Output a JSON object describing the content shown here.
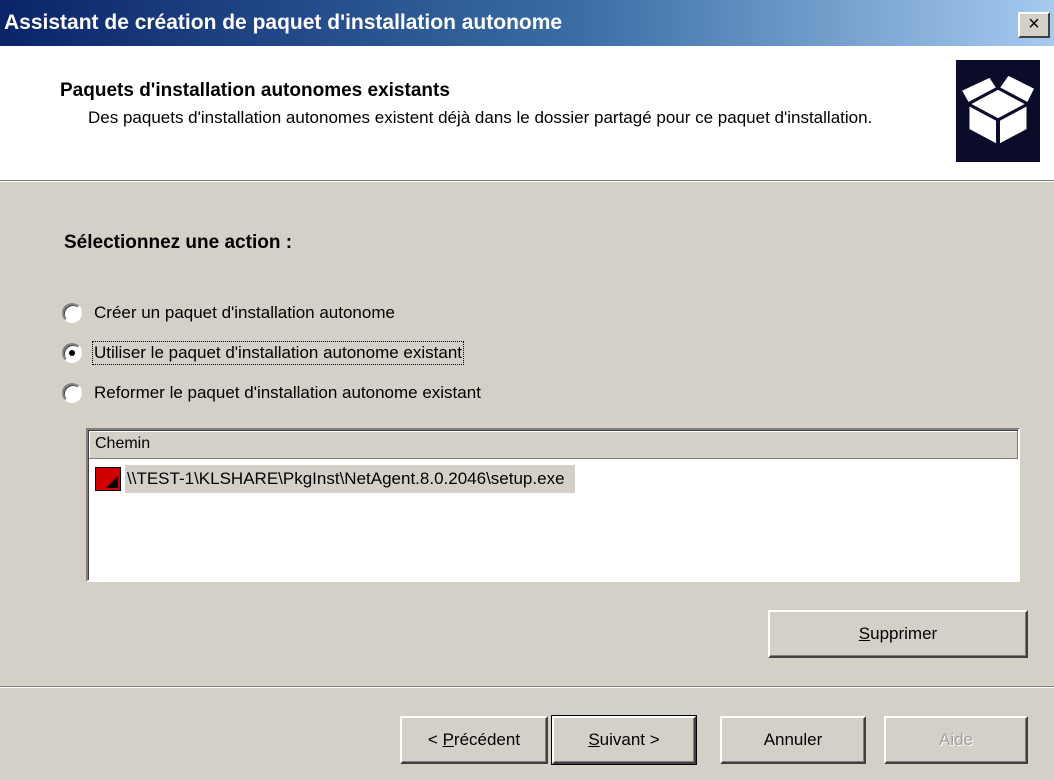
{
  "window": {
    "title": "Assistant de création de paquet d'installation autonome",
    "close_glyph": "×"
  },
  "header": {
    "title": "Paquets d'installation autonomes existants",
    "description": "Des paquets d'installation autonomes existent déjà dans le dossier partagé pour ce paquet d'installation.",
    "icon": "package-box-icon"
  },
  "section": {
    "label": "Sélectionnez une action :"
  },
  "options": [
    {
      "label": "Créer un paquet d'installation autonome",
      "selected": false
    },
    {
      "label": "Utiliser le paquet d'installation autonome existant",
      "selected": true
    },
    {
      "label": "Reformer le paquet d'installation autonome existant",
      "selected": false
    }
  ],
  "list": {
    "column_header": "Chemin",
    "rows": [
      {
        "path": "\\\\TEST-1\\KLSHARE\\PkgInst\\NetAgent.8.0.2046\\setup.exe",
        "icon": "kaspersky-icon"
      }
    ]
  },
  "buttons": {
    "delete": {
      "mnemonic": "S",
      "rest": "upprimer"
    },
    "previous": {
      "prefix": "< ",
      "mnemonic": "P",
      "rest": "récédent"
    },
    "next": {
      "mnemonic": "S",
      "rest": "uivant >"
    },
    "cancel": "Annuler",
    "help": "Aide"
  },
  "colors": {
    "title_gradient_start": "#0a246a",
    "title_gradient_end": "#a6caf0",
    "dialog_bg": "#d4d0c8",
    "icon_red": "#d10000"
  }
}
